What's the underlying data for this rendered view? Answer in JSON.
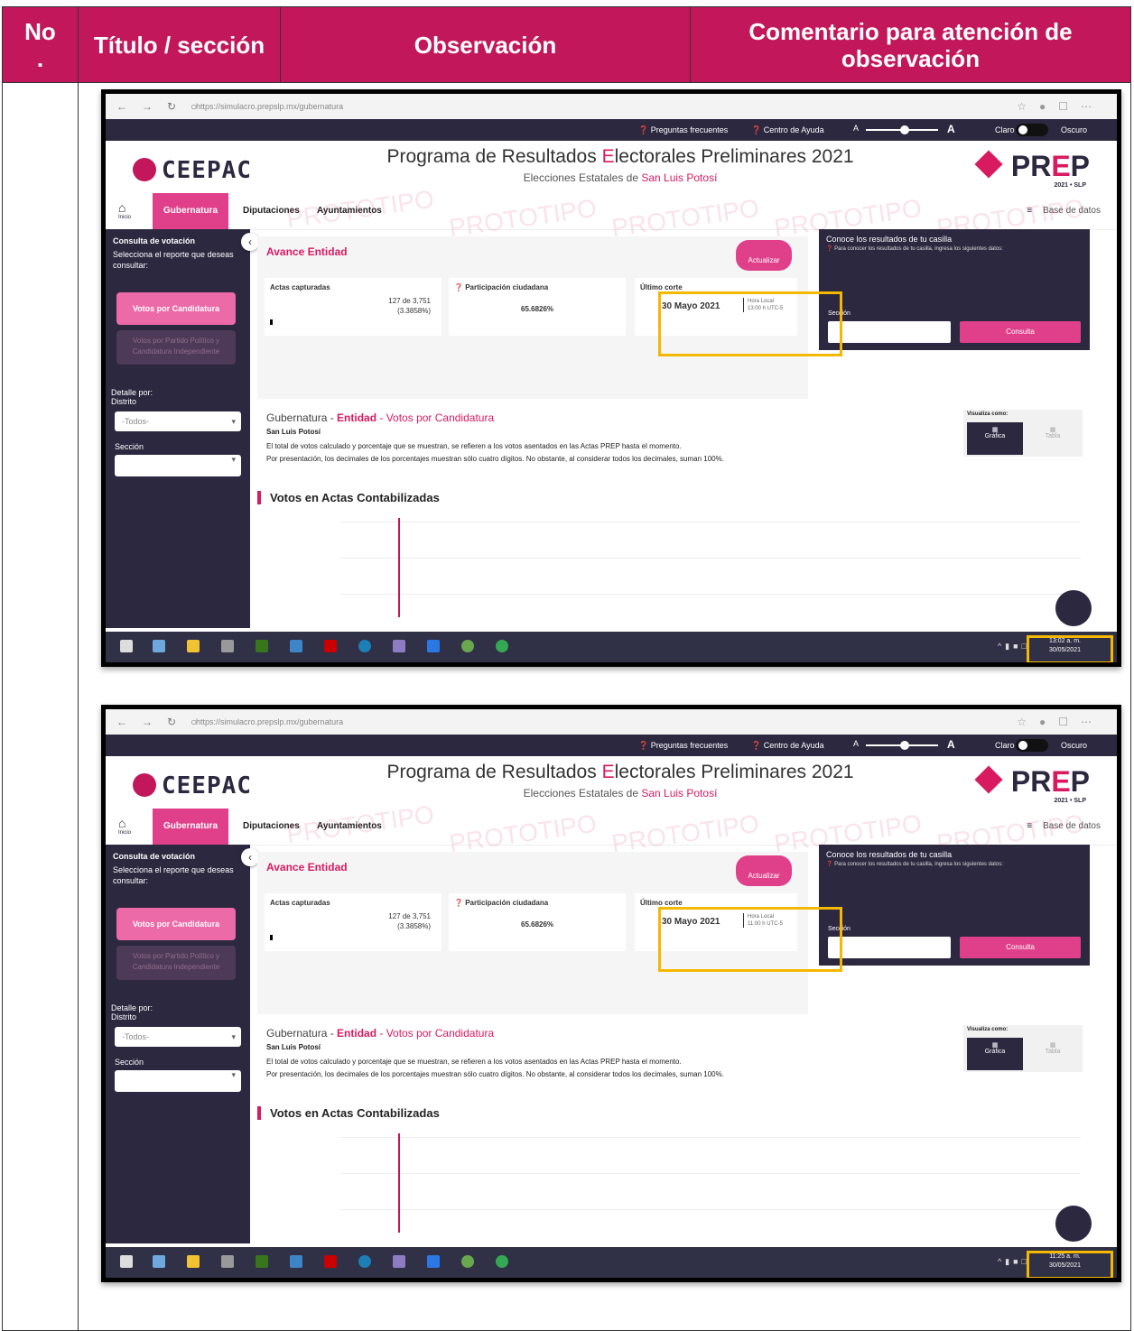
{
  "table": {
    "headers": {
      "no": "No\n.",
      "titulo": "Título / sección",
      "observacion": "Observación",
      "comentario": "Comentario para atención de observación"
    }
  },
  "screens": [
    {
      "browser": {
        "url": "https://simulacro.prepslp.mx/gubernatura"
      },
      "top": {
        "faq": "Preguntas frecuentes",
        "help": "Centro de Ayuda",
        "font_small": "A",
        "font_large": "A",
        "clear": "Claro",
        "dark": "Oscuro"
      },
      "header": {
        "logo": "CEEPAC",
        "title_pre": "Programa de Resultados ",
        "title_hl": "E",
        "title_post": "lectorales Preliminares 2021",
        "sub_pre": "Elecciones Estatales de ",
        "sub_hl": "San Luis Potosí",
        "prep_logo_a": "PR",
        "prep_logo_e": "E",
        "prep_logo_b": "P",
        "prep_small": "2021 • SLP"
      },
      "nav": {
        "home": "Inicio",
        "tab1": "Gubernatura",
        "tab2": "Diputaciones",
        "tab3": "Ayuntamientos",
        "db": "Base de datos"
      },
      "sidebar": {
        "heading": "Consulta de votación",
        "desc": "Selecciona el reporte que deseas consultar:",
        "btn_active": "Votos por Candidatura",
        "btn_inactive": "Votos por Partido Político y Candidatura Independiente",
        "detalle": "Detalle por:",
        "distrito": "Distrito",
        "distrito_value": "-Todos-",
        "seccion": "Sección"
      },
      "avance": {
        "title": "Avance Entidad",
        "update": "Actualizar",
        "actas_label": "Actas capturadas",
        "actas_value": "127 de 3,751",
        "actas_pct": "(3.3858%)",
        "part_label": "Participación ciudadana",
        "part_value": "65.6826%",
        "corte_label": "Último corte",
        "corte_date": "30 Mayo 2021",
        "corte_hora": "Hora Local",
        "corte_time": "13:00 h UTC-5"
      },
      "consulta": {
        "title": "Conoce los resultados de tu casilla",
        "sub": "Para conocer los resultados de tu casilla, ingresa los siguientes datos:",
        "seccion": "Sección",
        "button": "Consulta"
      },
      "gub": {
        "t1": "Gubernatura - ",
        "t2": "Entidad",
        "t3": " - Votos por Candidatura",
        "entity": "San Luis Potosí",
        "p1": "El total de votos calculado y porcentaje que se muestran, se refieren a los votos asentados en las Actas PREP hasta el momento.",
        "p2": "Por presentación, los decimales de los porcentajes muestran sólo cuatro dígitos. No obstante, al considerar todos los decimales, suman 100%.",
        "votos": "Votos en Actas Contabilizadas",
        "vis_label": "Visualiza como:",
        "vis_a": "Gráfica",
        "vis_b": "Tabla"
      },
      "taskbar": {
        "time": "13:02 a. m.",
        "date": "30/05/2021"
      }
    },
    {
      "browser": {
        "url": "https://simulacro.prepslp.mx/gubernatura"
      },
      "top": {
        "faq": "Preguntas frecuentes",
        "help": "Centro de Ayuda",
        "font_small": "A",
        "font_large": "A",
        "clear": "Claro",
        "dark": "Oscuro"
      },
      "header": {
        "logo": "CEEPAC",
        "title_pre": "Programa de Resultados ",
        "title_hl": "E",
        "title_post": "lectorales Preliminares 2021",
        "sub_pre": "Elecciones Estatales de ",
        "sub_hl": "San Luis Potosí",
        "prep_logo_a": "PR",
        "prep_logo_e": "E",
        "prep_logo_b": "P",
        "prep_small": "2021 • SLP"
      },
      "nav": {
        "home": "Inicio",
        "tab1": "Gubernatura",
        "tab2": "Diputaciones",
        "tab3": "Ayuntamientos",
        "db": "Base de datos"
      },
      "sidebar": {
        "heading": "Consulta de votación",
        "desc": "Selecciona el reporte que deseas consultar:",
        "btn_active": "Votos por Candidatura",
        "btn_inactive": "Votos por Partido Político y Candidatura Independiente",
        "detalle": "Detalle por:",
        "distrito": "Distrito",
        "distrito_value": "-Todos-",
        "seccion": "Sección"
      },
      "avance": {
        "title": "Avance Entidad",
        "update": "Actualizar",
        "actas_label": "Actas capturadas",
        "actas_value": "127 de 3,751",
        "actas_pct": "(3.3858%)",
        "part_label": "Participación ciudadana",
        "part_value": "65.6826%",
        "corte_label": "Último corte",
        "corte_date": "30 Mayo 2021",
        "corte_hora": "Hora Local",
        "corte_time": "11:00 h UTC-5"
      },
      "consulta": {
        "title": "Conoce los resultados de tu casilla",
        "sub": "Para conocer los resultados de tu casilla, ingresa los siguientes datos:",
        "seccion": "Sección",
        "button": "Consulta"
      },
      "gub": {
        "t1": "Gubernatura - ",
        "t2": "Entidad",
        "t3": " - Votos por Candidatura",
        "entity": "San Luis Potosí",
        "p1": "El total de votos calculado y porcentaje que se muestran, se refieren a los votos asentados en las Actas PREP hasta el momento.",
        "p2": "Por presentación, los decimales de los porcentajes muestran sólo cuatro dígitos. No obstante, al considerar todos los decimales, suman 100%.",
        "votos": "Votos en Actas Contabilizadas",
        "vis_label": "Visualiza como:",
        "vis_a": "Gráfica",
        "vis_b": "Tabla"
      },
      "taskbar": {
        "time": "11:25 a. m.",
        "date": "30/05/2021"
      }
    }
  ],
  "colors": {
    "header_bg": "#c2185b",
    "accent": "#e0408a",
    "dark": "#2b2840",
    "highlight": "#f5b800"
  },
  "watermark": "PROTOTIPO"
}
